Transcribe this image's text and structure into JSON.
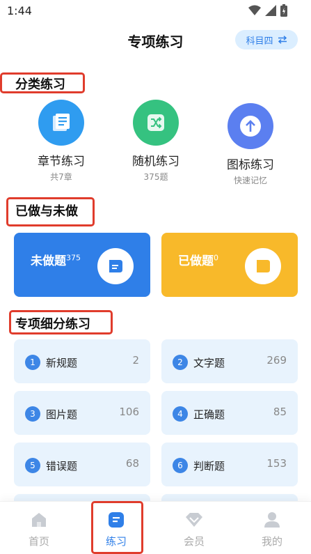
{
  "status": {
    "time": "1:44"
  },
  "header": {
    "title": "专项练习",
    "subject_label": "科目四"
  },
  "sections": {
    "category": "分类练习",
    "done_undone": "已做与未做",
    "breakdown": "专项细分练习"
  },
  "categories": [
    {
      "label": "章节练习",
      "sub": "共7章",
      "color": "#2f9cf0",
      "icon": "book-icon"
    },
    {
      "label": "随机练习",
      "sub": "375题",
      "color": "#35c280",
      "icon": "shuffle-icon"
    },
    {
      "label": "图标练习",
      "sub": "快速记忆",
      "color": "#5b7ff0",
      "icon": "arrow-up-icon"
    }
  ],
  "cards": {
    "undone": {
      "label": "未做题",
      "count": "375",
      "color": "#2f7fe8"
    },
    "done": {
      "label": "已做题",
      "count": "0",
      "color": "#f8b92a"
    }
  },
  "breakdown": [
    {
      "num": "1",
      "label": "新规题",
      "count": "2"
    },
    {
      "num": "2",
      "label": "文字题",
      "count": "269"
    },
    {
      "num": "3",
      "label": "图片题",
      "count": "106"
    },
    {
      "num": "4",
      "label": "正确题",
      "count": "85"
    },
    {
      "num": "5",
      "label": "错误题",
      "count": "68"
    },
    {
      "num": "6",
      "label": "判断题",
      "count": "153"
    }
  ],
  "tabs": [
    {
      "label": "首页",
      "icon": "home-icon"
    },
    {
      "label": "练习",
      "icon": "practice-icon",
      "active": true
    },
    {
      "label": "会员",
      "icon": "diamond-icon"
    },
    {
      "label": "我的",
      "icon": "user-icon"
    }
  ]
}
